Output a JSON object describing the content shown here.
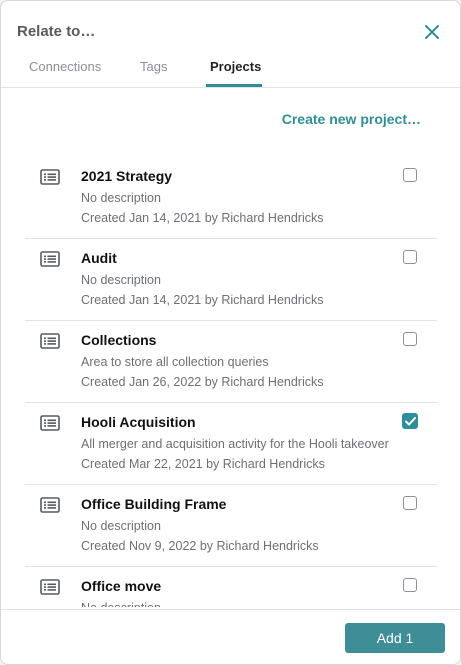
{
  "dialog": {
    "title": "Relate to…",
    "close_icon": "close-icon"
  },
  "tabs": [
    {
      "label": "Connections",
      "active": false
    },
    {
      "label": "Tags",
      "active": false
    },
    {
      "label": "Projects",
      "active": true
    }
  ],
  "create_link": "Create new project…",
  "projects": [
    {
      "name": "2021 Strategy",
      "description": "No description",
      "meta": "Created Jan 14, 2021 by Richard Hendricks",
      "checked": false,
      "icon": "list-icon"
    },
    {
      "name": "Audit",
      "description": "No description",
      "meta": "Created Jan 14, 2021 by Richard Hendricks",
      "checked": false,
      "icon": "list-icon"
    },
    {
      "name": "Collections",
      "description": "Area to store all collection queries",
      "meta": "Created Jan 26, 2022 by Richard Hendricks",
      "checked": false,
      "icon": "list-icon"
    },
    {
      "name": "Hooli Acquisition",
      "description": "All merger and acquisition activity for the Hooli takeover",
      "meta": "Created Mar 22, 2021 by Richard Hendricks",
      "checked": true,
      "icon": "list-icon"
    },
    {
      "name": "Office Building Frame",
      "description": "No description",
      "meta": "Created Nov 9, 2022 by Richard Hendricks",
      "checked": false,
      "icon": "list-icon"
    },
    {
      "name": "Office move",
      "description": "No description",
      "meta": "",
      "checked": false,
      "icon": "list-icon"
    }
  ],
  "footer": {
    "add_label": "Add 1"
  },
  "colors": {
    "accent": "#2f8f99",
    "button": "#3f8e97",
    "text": "#1f2328",
    "muted": "#6b7076"
  }
}
